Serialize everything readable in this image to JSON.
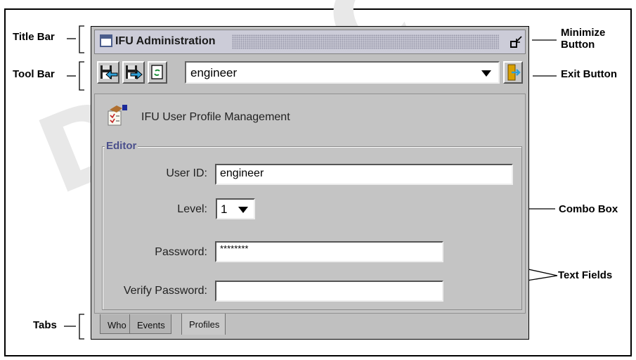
{
  "callouts": {
    "title_bar": "Title Bar",
    "tool_bar": "Tool Bar",
    "tabs": "Tabs",
    "minimize": "Minimize Button",
    "exit": "Exit Button",
    "combo_box": "Combo Box",
    "text_fields": "Text Fields"
  },
  "window": {
    "title": "IFU Administration",
    "toolbar": {
      "combo_value": "engineer"
    },
    "header": "IFU User Profile Management",
    "editor": {
      "group_label": "Editor",
      "user_id_label": "User ID:",
      "user_id_value": "engineer",
      "level_label": "Level:",
      "level_value": "1",
      "password_label": "Password:",
      "password_value": "********",
      "verify_label": "Verify Password:",
      "verify_value": ""
    },
    "tabs": [
      "Who",
      "Events",
      "Profiles"
    ],
    "active_tab": "Profiles"
  },
  "colors": {
    "accent": "#4a4f8c",
    "window_bg": "#c0c0c0"
  }
}
